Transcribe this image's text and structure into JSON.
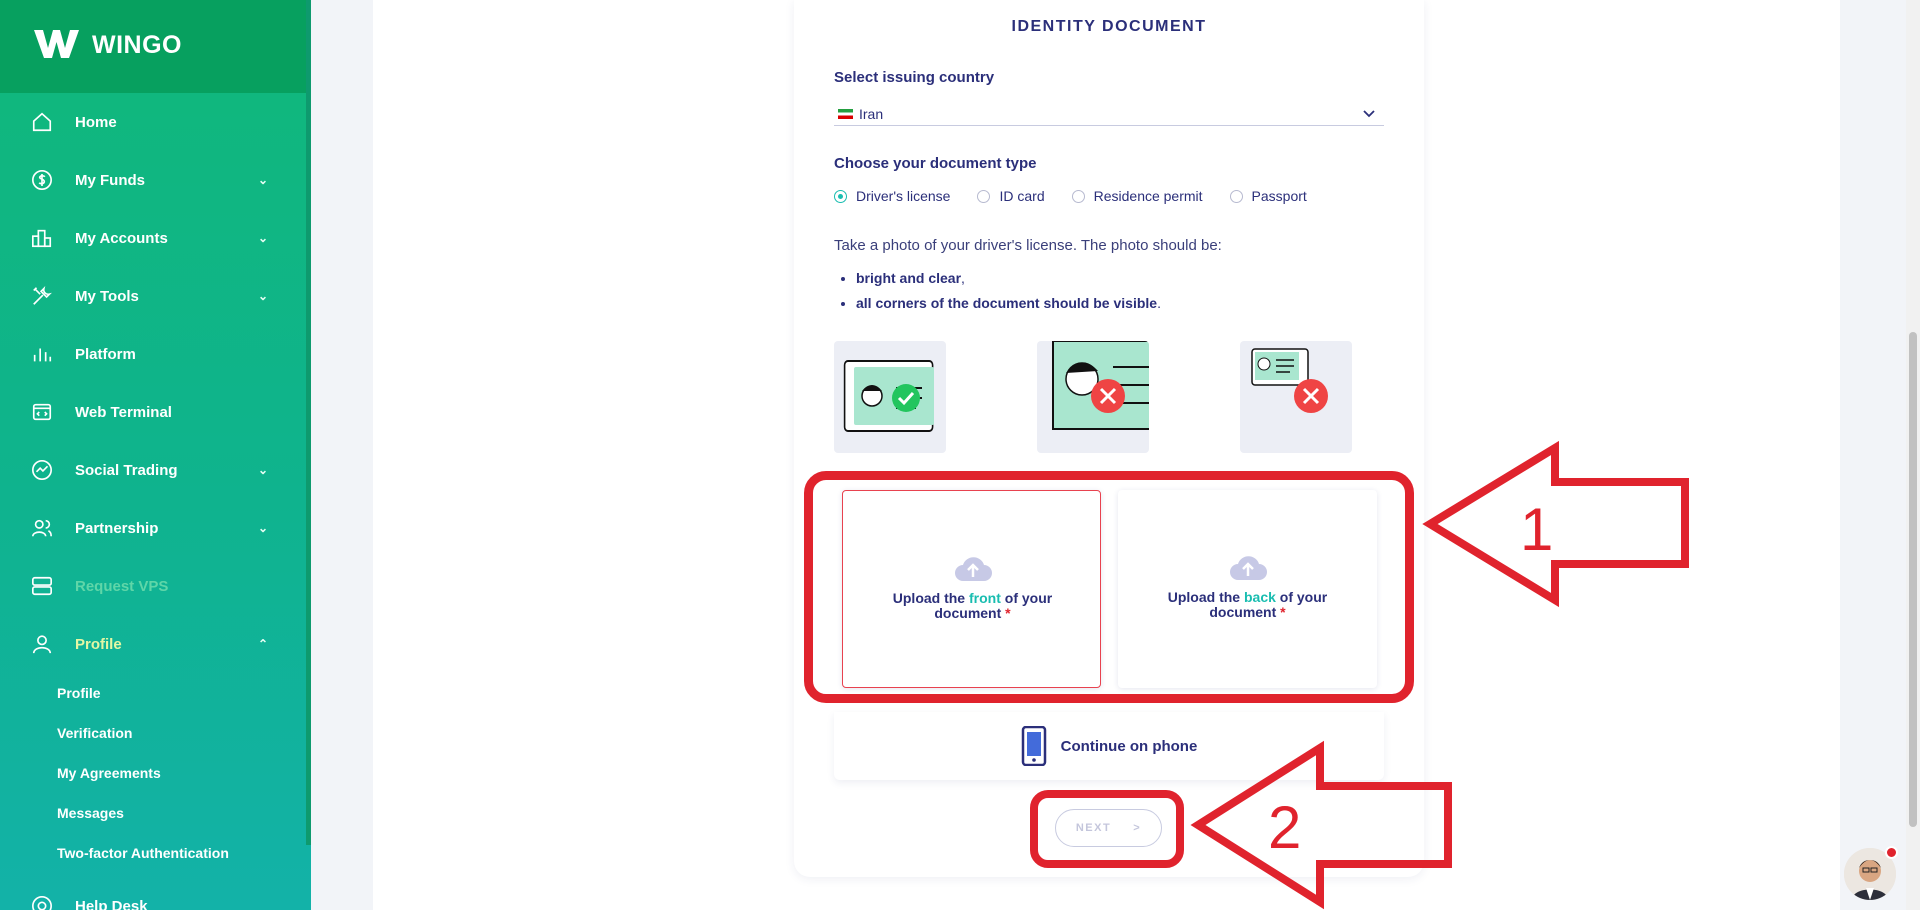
{
  "app": {
    "brand": "WINGO"
  },
  "sidebar": {
    "items": [
      {
        "label": "Home",
        "icon": "home-icon",
        "has_chevron": false
      },
      {
        "label": "My Funds",
        "icon": "dollar-icon",
        "has_chevron": true
      },
      {
        "label": "My Accounts",
        "icon": "accounts-icon",
        "has_chevron": true
      },
      {
        "label": "My Tools",
        "icon": "tools-icon",
        "has_chevron": true
      },
      {
        "label": "Platform",
        "icon": "chart-bars-icon",
        "has_chevron": false
      },
      {
        "label": "Web Terminal",
        "icon": "terminal-icon",
        "has_chevron": false
      },
      {
        "label": "Social Trading",
        "icon": "trend-icon",
        "has_chevron": true
      },
      {
        "label": "Partnership",
        "icon": "people-icon",
        "has_chevron": true
      },
      {
        "label": "Request VPS",
        "icon": "server-icon",
        "has_chevron": false,
        "disabled": true
      },
      {
        "label": "Profile",
        "icon": "user-icon",
        "has_chevron": true,
        "expanded": true
      }
    ],
    "profile_sub": [
      "Profile",
      "Verification",
      "My Agreements",
      "Messages",
      "Two-factor Authentication"
    ],
    "bottom_item": {
      "label": "Help Desk",
      "icon": "help-icon"
    }
  },
  "form": {
    "title": "IDENTITY DOCUMENT",
    "country_label": "Select issuing country",
    "country_value": "Iran",
    "doctype_label": "Choose your document type",
    "doc_types": [
      "Driver's license",
      "ID card",
      "Residence permit",
      "Passport"
    ],
    "selected_doc_type": "Driver's license",
    "instruction": "Take a photo of your driver's license. The photo should be:",
    "bullets": [
      {
        "bold": "bright and clear",
        "tail": ","
      },
      {
        "bold": "all corners of the document should be visible",
        "tail": "."
      }
    ],
    "upload_front": {
      "pre": "Upload the ",
      "hl": "front",
      "post": " of your document",
      "req": " *"
    },
    "upload_back": {
      "pre": "Upload the ",
      "hl": "back",
      "post": " of your document",
      "req": " *"
    },
    "phone_label": "Continue on phone",
    "next_label": "NEXT",
    "next_arrow": ">"
  },
  "annotations": {
    "label_1": "1",
    "label_2": "2"
  },
  "colors": {
    "brand_green": "#10b87a",
    "accent_teal": "#19bdb0",
    "navy": "#2b2f7a",
    "annotation_red": "#e0232d"
  }
}
